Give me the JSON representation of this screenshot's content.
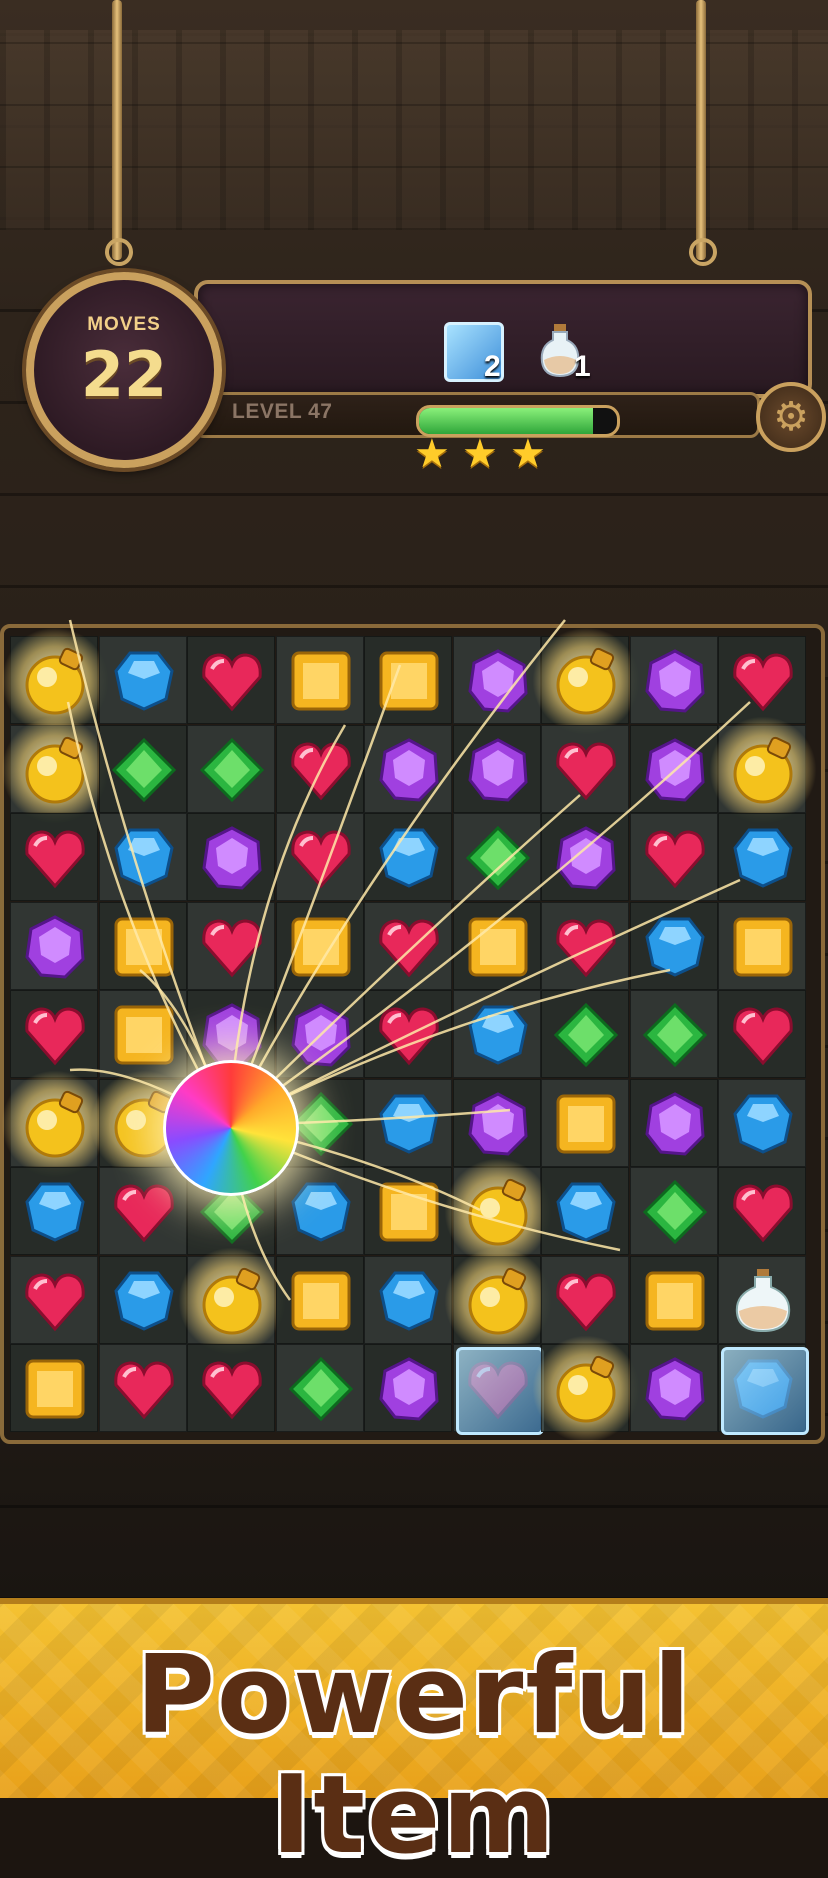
{
  "hud": {
    "moves_label": "MOVES",
    "moves_value": "22",
    "level_label": "LEVEL 47",
    "progress_fraction": 0.88,
    "stars_earned": 3,
    "goals": [
      {
        "icon": "ice-block-icon",
        "count": "2"
      },
      {
        "icon": "potion-bottle-icon",
        "count": "1"
      }
    ]
  },
  "board": {
    "rows": 9,
    "cols": 9,
    "grid": [
      [
        "bomb",
        "blue",
        "red",
        "yellow",
        "yellow",
        "purple",
        "bomb",
        "purple",
        "red"
      ],
      [
        "bomb",
        "green",
        "green",
        "red",
        "purple",
        "purple",
        "red",
        "purple",
        "bomb"
      ],
      [
        "red",
        "blue",
        "purple",
        "red",
        "blue",
        "green",
        "purple",
        "red",
        "blue"
      ],
      [
        "purple",
        "yellow",
        "red",
        "yellow",
        "red",
        "yellow",
        "red",
        "blue",
        "yellow"
      ],
      [
        "red",
        "yellow",
        "purple",
        "purple",
        "red",
        "blue",
        "green",
        "green",
        "red"
      ],
      [
        "bomb",
        "bomb",
        "rainbow",
        "green",
        "blue",
        "purple",
        "yellow",
        "purple",
        "blue"
      ],
      [
        "blue",
        "red",
        "green",
        "blue",
        "yellow",
        "bomb",
        "blue",
        "green",
        "red"
      ],
      [
        "red",
        "blue",
        "bomb",
        "yellow",
        "blue",
        "bomb",
        "red",
        "yellow",
        "potion"
      ],
      [
        "yellow",
        "red",
        "red",
        "green",
        "purple",
        "ice-red",
        "bomb",
        "purple",
        "ice-blue"
      ]
    ]
  },
  "colors": {
    "red": "#e8285a",
    "blue": "#2a9be8",
    "yellow": "#f5b520",
    "green": "#2bb640",
    "purple": "#a040e0",
    "bomb": "#f4c21c",
    "banner_text": "#5a2e14",
    "banner_bg": "#f0b426"
  },
  "banner": {
    "text": "Powerful Item"
  }
}
